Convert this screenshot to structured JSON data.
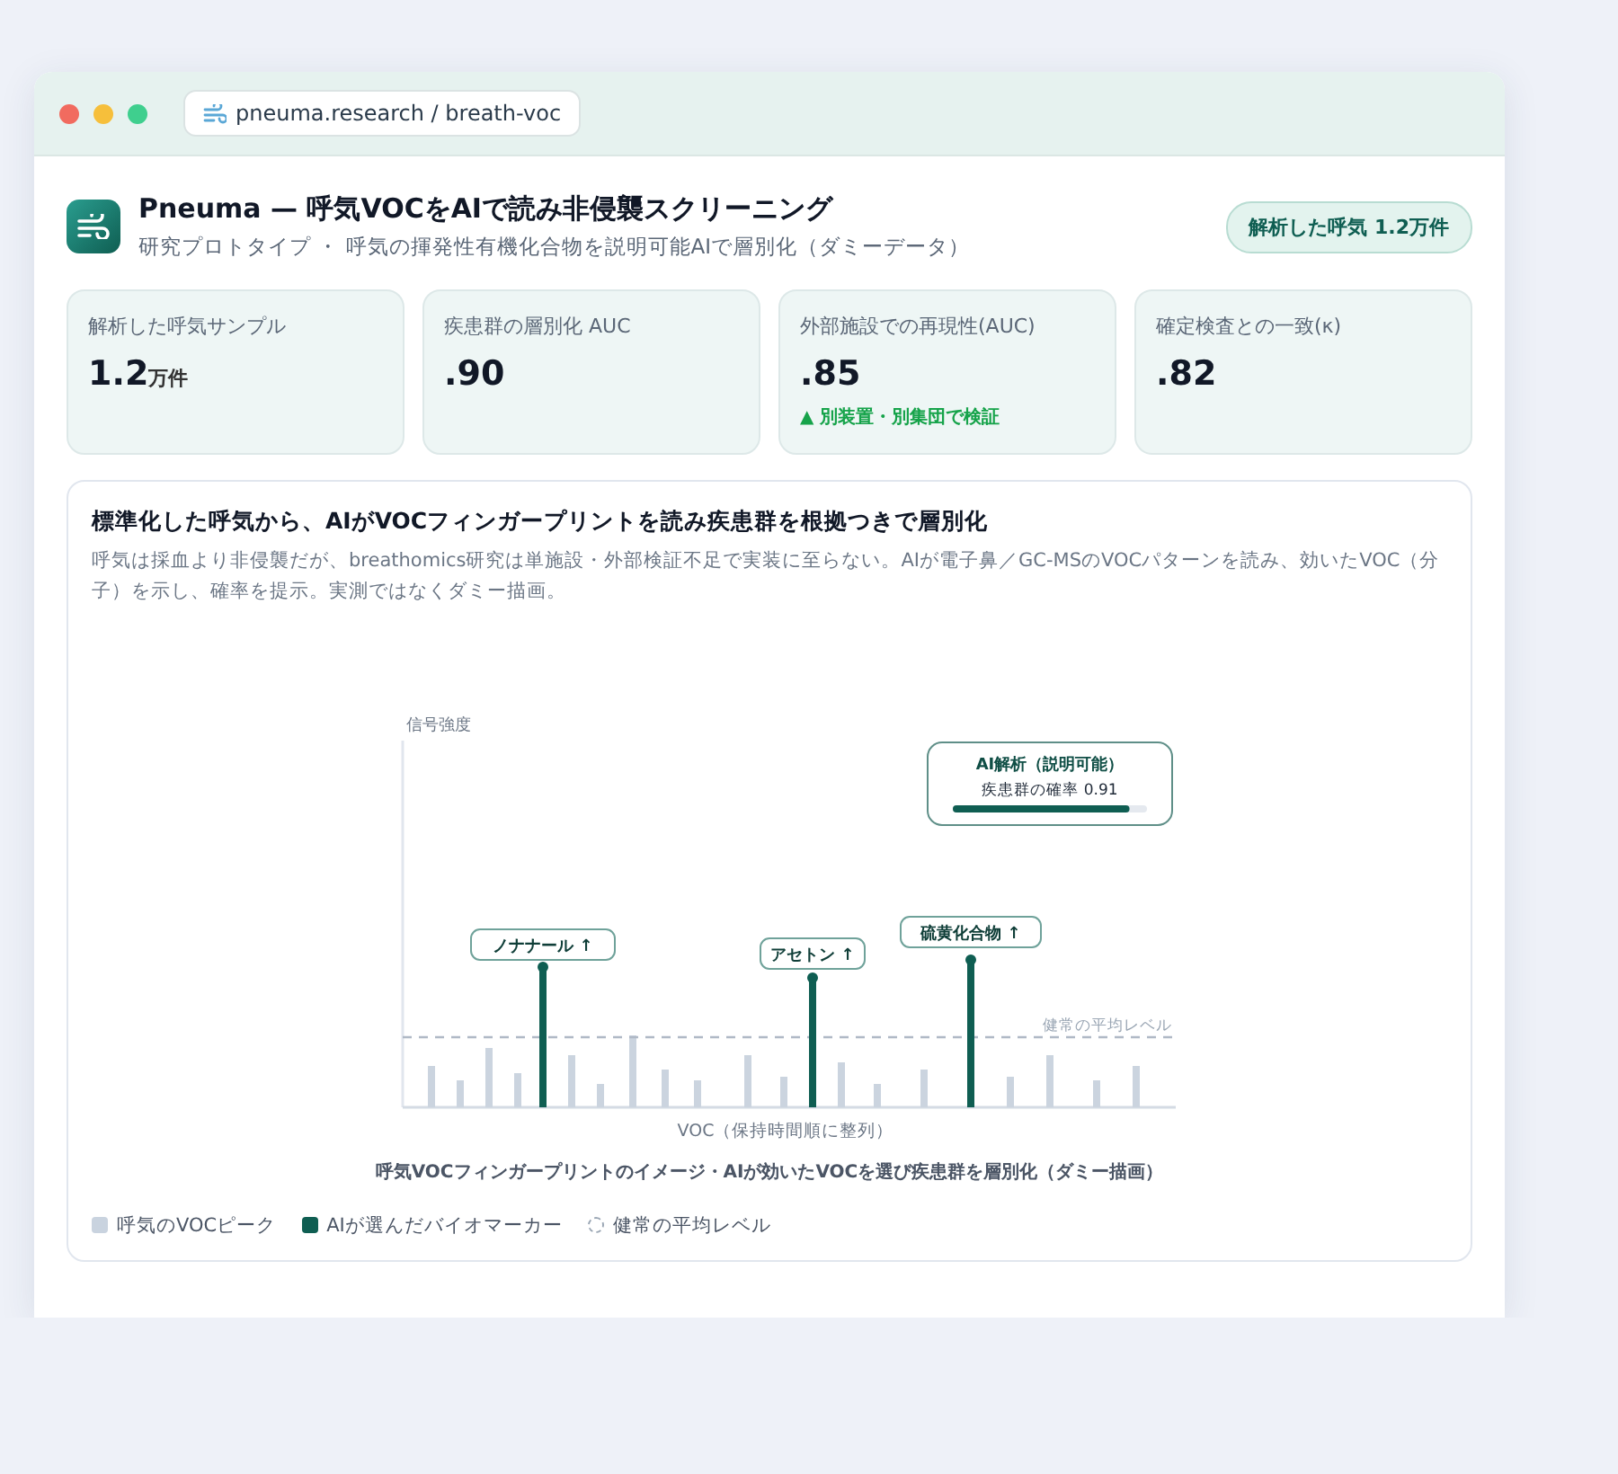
{
  "window": {
    "url": "pneuma.research / breath-voc"
  },
  "header": {
    "title": "Pneuma — 呼気VOCをAIで読み非侵襲スクリーニング",
    "subtitle": "研究プロトタイプ ・ 呼気の揮発性有機化合物を説明可能AIで層別化（ダミーデータ）",
    "badge": "解析した呼気 1.2万件"
  },
  "stats": [
    {
      "label": "解析した呼気サンプル",
      "value": "1.2",
      "unit": "万件"
    },
    {
      "label": "疾患群の層別化 AUC",
      "value": ".90"
    },
    {
      "label": "外部施設での再現性(AUC)",
      "value": ".85",
      "note": "▲ 別装置・別集団で検証"
    },
    {
      "label": "確定検査との一致(κ)",
      "value": ".82"
    }
  ],
  "panel": {
    "title": "標準化した呼気から、AIがVOCフィンガープリントを読み疾患群を根拠つきで層別化",
    "description": "呼気は採血より非侵襲だが、breathomics研究は単施設・外部検証不足で実装に至らない。AIが電子鼻／GC-MSのVOCパターンを読み、効いたVOC（分子）を示し、確率を提示。実測ではなくダミー描画。",
    "chart": {
      "ylabel": "信号強度",
      "xlabel": "VOC（保持時間順に整列）",
      "baseline_label": "健常の平均レベル",
      "markers": [
        {
          "label": "ノナナール ↑"
        },
        {
          "label": "アセトン ↑"
        },
        {
          "label": "硫黄化合物 ↑"
        }
      ],
      "ai_box": {
        "title": "AI解析（説明可能）",
        "reading": "疾患群の確率 0.91",
        "level": 0.91
      }
    },
    "caption": "呼気VOCフィンガープリントのイメージ・AIが効いたVOCを選び疾患群を層別化（ダミー描画）",
    "legend": [
      {
        "kind": "peak",
        "label": "呼気のVOCピーク"
      },
      {
        "kind": "marker",
        "label": "AIが選んだバイオマーカー"
      },
      {
        "kind": "baseline",
        "label": "健常の平均レベル"
      }
    ]
  }
}
